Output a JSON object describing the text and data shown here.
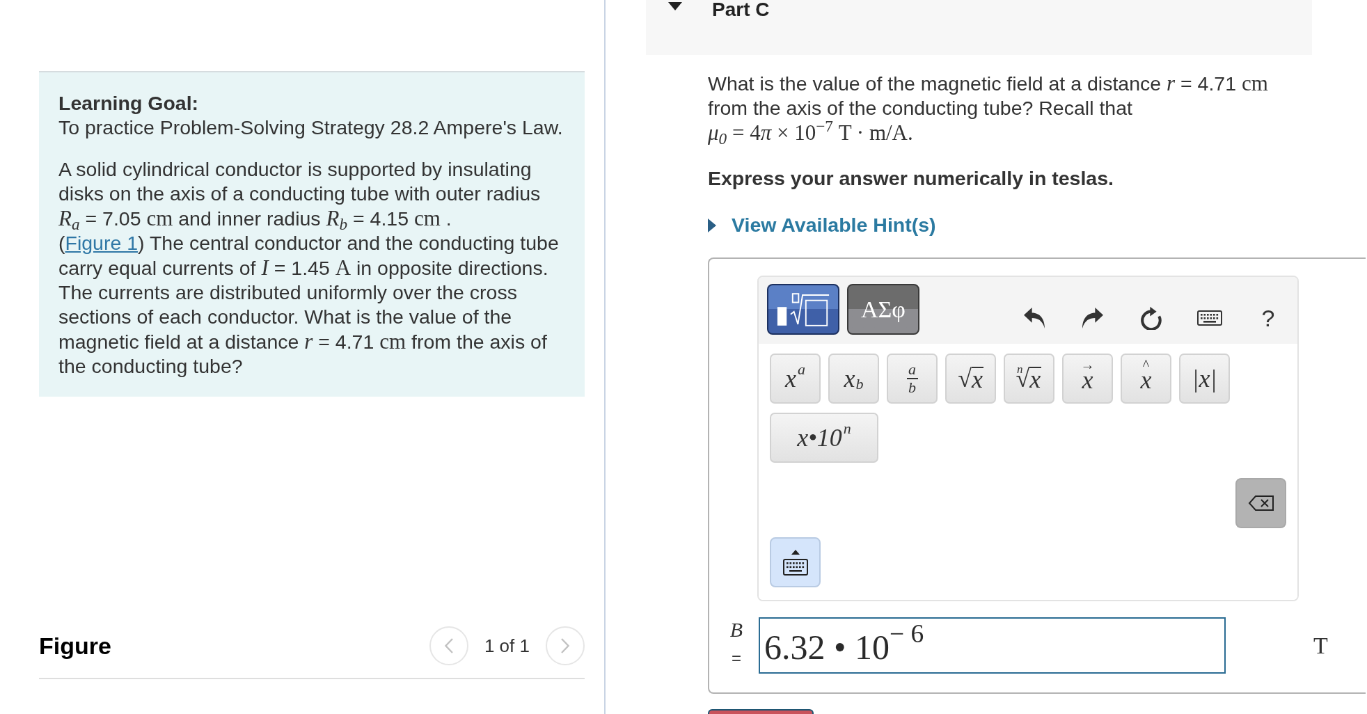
{
  "problem_panel": {
    "heading": "Learning Goal:",
    "goal": "To practice Problem-Solving Strategy 28.2 Ampere's Law.",
    "statement": [
      {
        "kind": "text",
        "text": "A solid cylindrical conductor is supported by insulating disks on the axis of a conducting tube with outer radius "
      },
      {
        "kind": "quantity",
        "symbol": "R$_{a}$",
        "value": " = 7.05 ",
        "unit": "cm"
      },
      {
        "kind": "text",
        "text": " and inner radius "
      },
      {
        "kind": "quantity",
        "symbol": "R$_{b}$",
        "value": " = 4.15 ",
        "unit": "cm"
      },
      {
        "kind": "text",
        "text": " ."
      },
      {
        "kind": "break"
      },
      {
        "kind": "text",
        "text": "("
      },
      {
        "kind": "link",
        "text": "Figure 1"
      },
      {
        "kind": "text",
        "text": ") The central conductor and the conducting tube carry equal currents of "
      },
      {
        "kind": "quantity",
        "symbol": "I",
        "value": " = 1.45 ",
        "unit": "A"
      },
      {
        "kind": "text",
        "text": " in opposite directions. The currents are distributed uniformly over the cross sections of each conductor. What is the value of the magnetic field at a distance "
      },
      {
        "kind": "quantity",
        "symbol": "r",
        "value": " = 4.71 ",
        "unit": "cm"
      },
      {
        "kind": "text",
        "text": " from the axis of the conducting tube?"
      }
    ]
  },
  "figure": {
    "title": "Figure",
    "pager": "1 of 1"
  },
  "part": {
    "title": "Part C",
    "expanded": true,
    "question": [
      {
        "kind": "text",
        "text": "What is the value of the magnetic field at a distance "
      },
      {
        "kind": "quantity",
        "symbol": "r",
        "value": " = 4.71 ",
        "unit": "cm"
      },
      {
        "kind": "text",
        "text": " from the axis of the conducting tube? Recall that "
      },
      {
        "kind": "formula",
        "pieces": [
          {
            "kind": "var",
            "text": "μ$_{0}$"
          },
          {
            "kind": "plain",
            "text": " = 4"
          },
          {
            "kind": "var",
            "text": "π"
          },
          {
            "kind": "plain",
            "text": " × 10$^{−7}$ T · m/A."
          }
        ]
      }
    ],
    "instruction": "Express your answer numerically in teslas.",
    "hints": {
      "label": "View Available Hint(s)",
      "expanded": false
    }
  },
  "math_input": {
    "palettes": [
      {
        "kind": "templates",
        "selected": true
      },
      {
        "kind": "symbols",
        "label": "ΑΣφ",
        "selected": false
      }
    ],
    "help": "?",
    "keys": [
      [
        {
          "kind": "power",
          "base": "x",
          "sup": "a"
        },
        {
          "kind": "subscript",
          "base": "x",
          "sub": "b"
        },
        {
          "kind": "fraction",
          "top": "a",
          "bottom": "b"
        },
        {
          "kind": "sqrt",
          "sign": "√",
          "radicand": "x"
        },
        {
          "kind": "nthroot",
          "index": "n",
          "sign": "√",
          "radicand": "x"
        },
        {
          "kind": "vector",
          "accent": "→",
          "base": "x"
        },
        {
          "kind": "hat",
          "accent": "^",
          "base": "x"
        },
        {
          "kind": "abs",
          "text": "|x|"
        }
      ],
      [
        {
          "kind": "sci",
          "base": "x•10",
          "sup": "n"
        }
      ]
    ]
  },
  "answer": {
    "variable": "B",
    "equals": "=",
    "value": "6.32 • 10$^{− 6}$",
    "unit": "T"
  }
}
